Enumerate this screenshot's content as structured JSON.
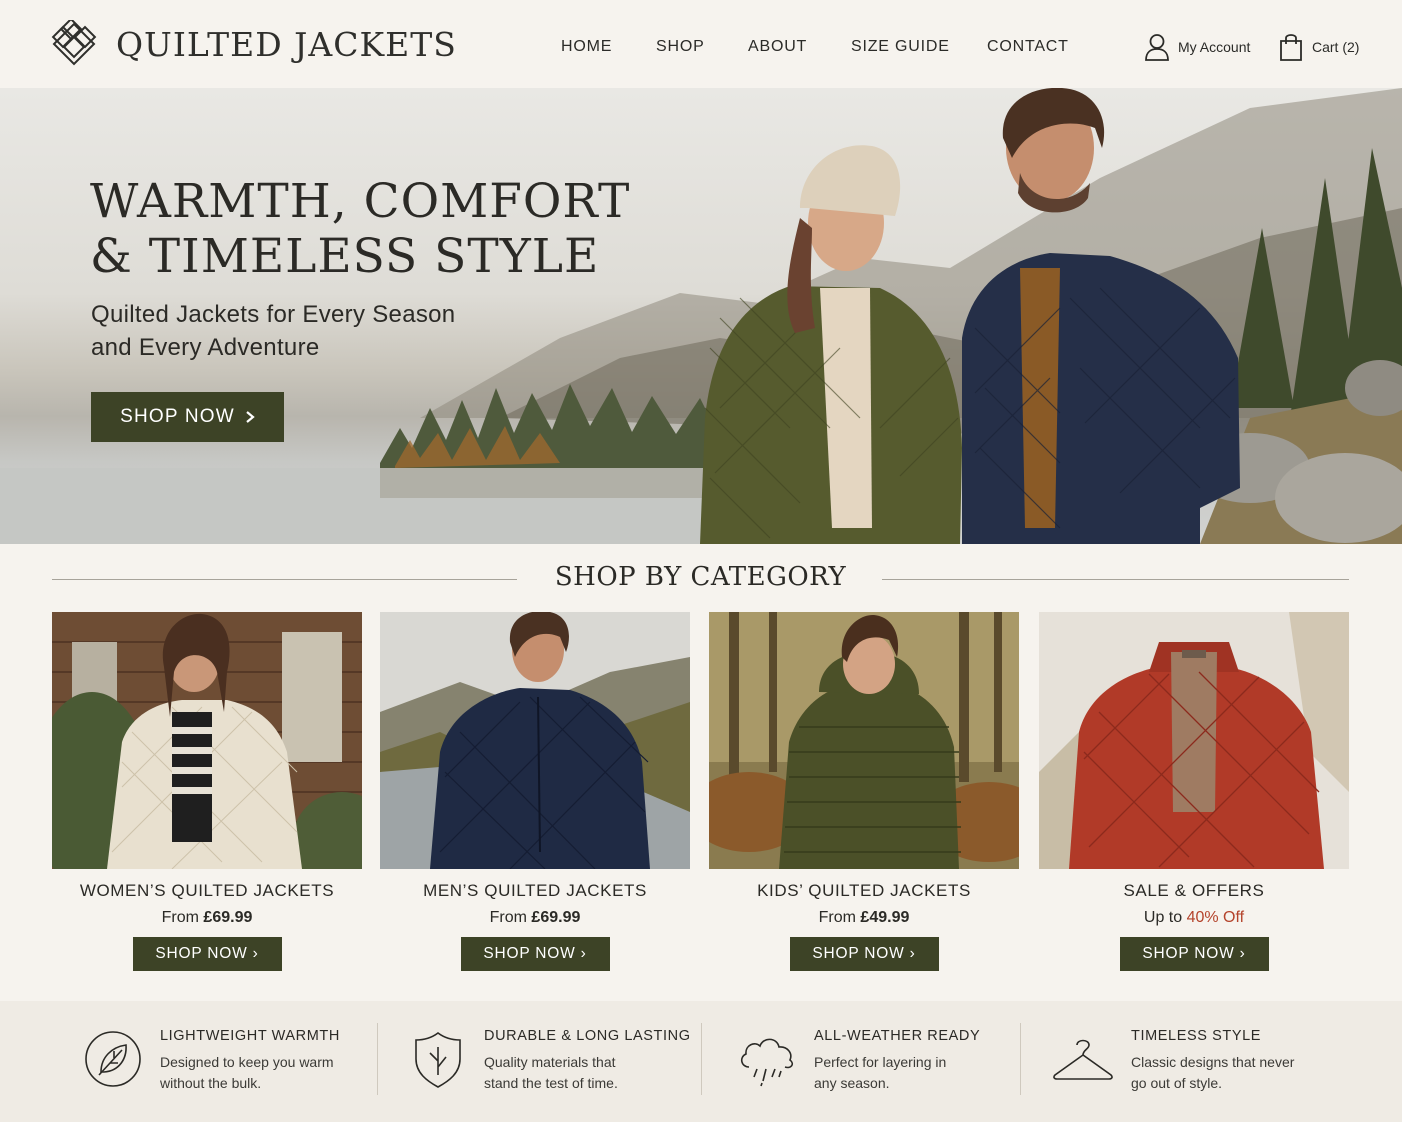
{
  "header": {
    "brand": "QUILTED JACKETS",
    "nav": [
      "HOME",
      "SHOP",
      "ABOUT",
      "SIZE GUIDE",
      "CONTACT"
    ],
    "account_label": "My Account",
    "cart_label": "Cart (2)",
    "icons": {
      "logo": "diamond-quilt-logo-icon",
      "account": "user-icon",
      "cart": "shopping-bag-icon"
    }
  },
  "hero": {
    "title_line1": "WARMTH, COMFORT",
    "title_line2": "& TIMELESS STYLE",
    "subtitle_line1": "Quilted Jackets for Every Season",
    "subtitle_line2": "and Every Adventure",
    "cta": "SHOP NOW",
    "cta_icon": "chevron-right-icon"
  },
  "categories": {
    "title": "SHOP BY CATEGORY",
    "items": [
      {
        "name": "WOMEN’S QUILTED JACKETS",
        "price_prefix": "From ",
        "price": "£69.99",
        "cta": "SHOP NOW ›"
      },
      {
        "name": "MEN’S QUILTED JACKETS",
        "price_prefix": "From ",
        "price": "£69.99",
        "cta": "SHOP NOW ›"
      },
      {
        "name": "KIDS’ QUILTED JACKETS",
        "price_prefix": "From ",
        "price": "£49.99",
        "cta": "SHOP NOW ›"
      },
      {
        "name": "SALE & OFFERS",
        "price_prefix": "Up to ",
        "price": "40% Off",
        "cta": "SHOP NOW ›"
      }
    ]
  },
  "features": [
    {
      "icon": "leaf-icon",
      "title": "LIGHTWEIGHT WARMTH",
      "desc1": "Designed to keep you warm",
      "desc2": "without the bulk."
    },
    {
      "icon": "shield-icon",
      "title": "DURABLE & LONG LASTING",
      "desc1": "Quality materials that",
      "desc2": "stand the test of time."
    },
    {
      "icon": "rain-cloud-icon",
      "title": "ALL-WEATHER READY",
      "desc1": "Perfect for layering in",
      "desc2": "any season."
    },
    {
      "icon": "hanger-icon",
      "title": "TIMELESS STYLE",
      "desc1": "Classic designs that never",
      "desc2": "go out of style."
    }
  ],
  "colors": {
    "background": "#f6f3ee",
    "button": "#3d4326",
    "sale_accent": "#b4432b",
    "text": "#2b2a26"
  }
}
